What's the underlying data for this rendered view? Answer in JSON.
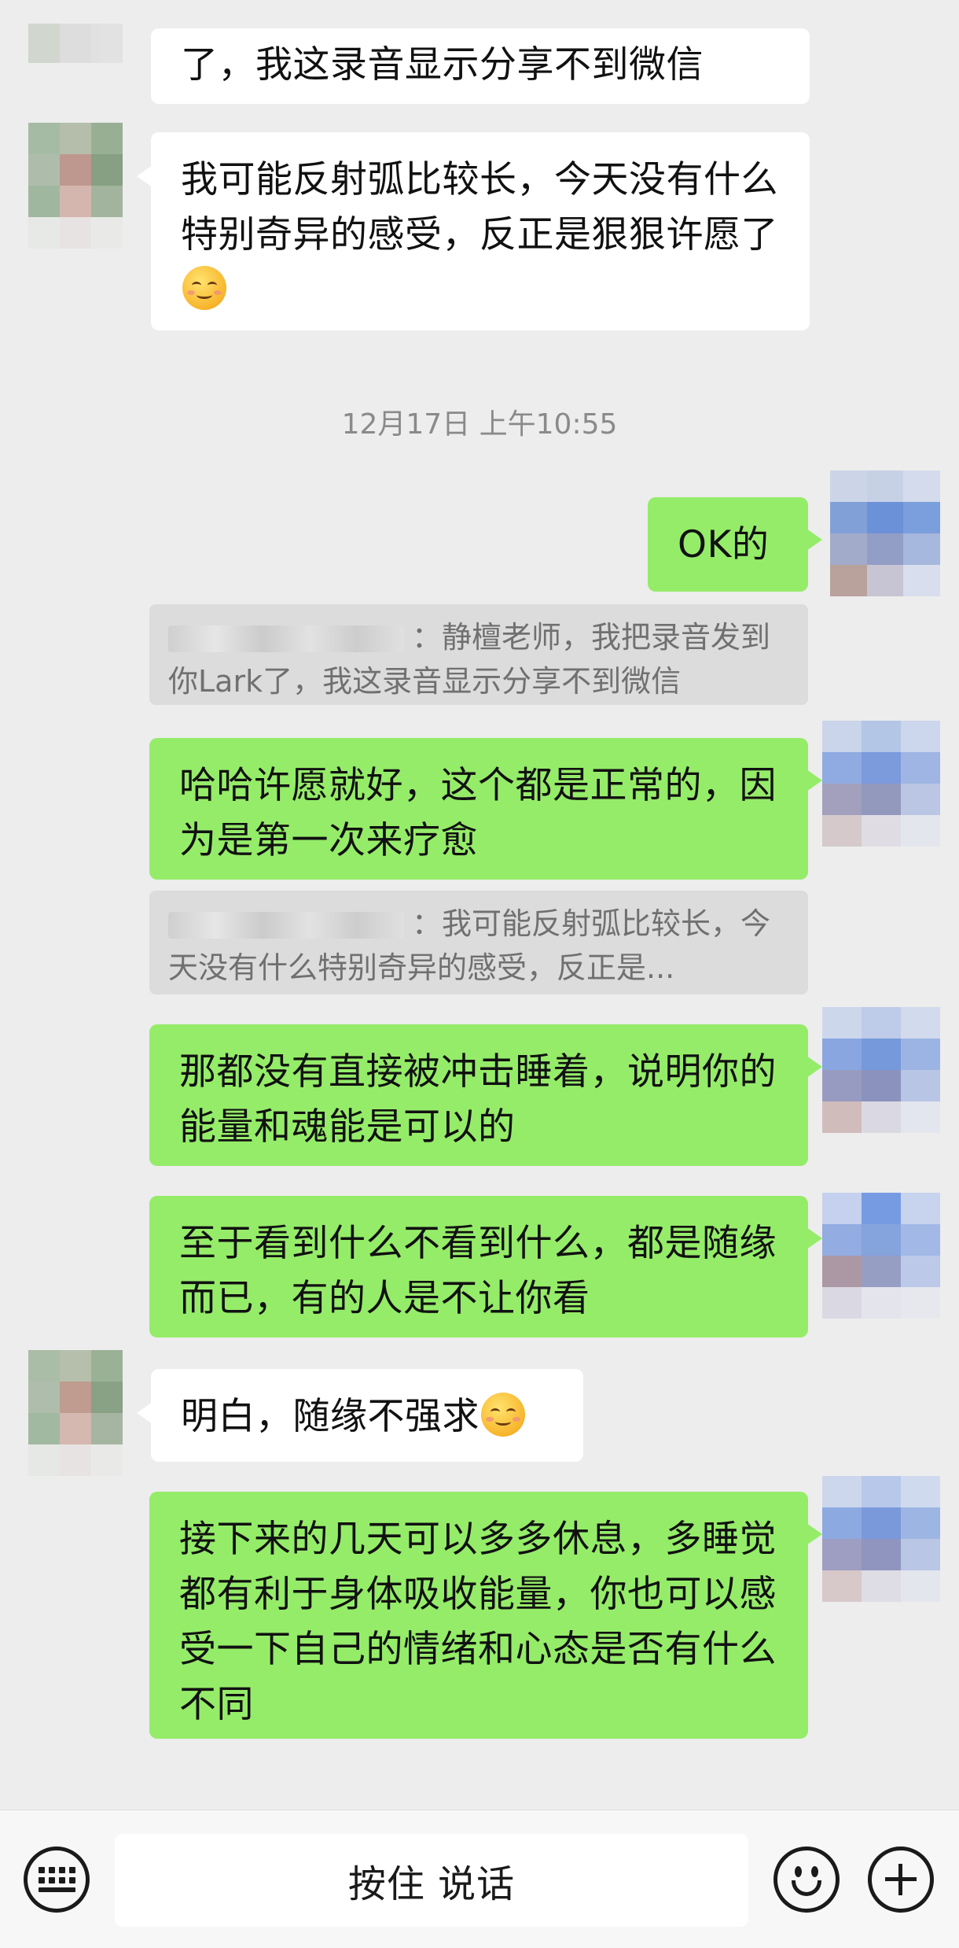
{
  "messages": [
    {
      "side": "in",
      "text": "了，我这录音显示分享不到微信"
    },
    {
      "side": "in",
      "text": "我可能反射弧比较长，今天没有什么特别奇异的感受，反正是狠狠许愿了",
      "emoji": "smiling-blush-emoji"
    },
    {
      "side": "out",
      "text": "OK的"
    },
    {
      "side": "out",
      "text": "哈哈许愿就好，这个都是正常的，因为是第一次来疗愈"
    },
    {
      "side": "out",
      "text": "那都没有直接被冲击睡着，说明你的能量和魂能是可以的"
    },
    {
      "side": "out",
      "text": "至于看到什么不看到什么，都是随缘而已，有的人是不让你看"
    },
    {
      "side": "in",
      "text": "明白，随缘不强求",
      "emoji": "smile-emoji"
    },
    {
      "side": "out",
      "text": "接下来的几天可以多多休息，多睡觉都有利于身体吸收能量，你也可以感受一下自己的情绪和心态是否有什么不同"
    }
  ],
  "timestamp": "12月17日 上午10:55",
  "quotes": [
    {
      "text": "：静檀老师，我把录音发到你Lark了，我这录音显示分享不到微信"
    },
    {
      "text": "：我可能反射弧比较长，今天没有什么特别奇异的感受，反正是..."
    }
  ],
  "bottom_bar": {
    "talk_label": "按住 说话",
    "keyboard_icon": "keyboard-icon",
    "emoji_icon": "emoji-icon",
    "plus_icon": "plus-icon"
  },
  "colors": {
    "background": "#ededed",
    "outgoing_bubble": "#95ec69",
    "incoming_bubble": "#ffffff",
    "quote_bg": "#dcdcdc"
  }
}
